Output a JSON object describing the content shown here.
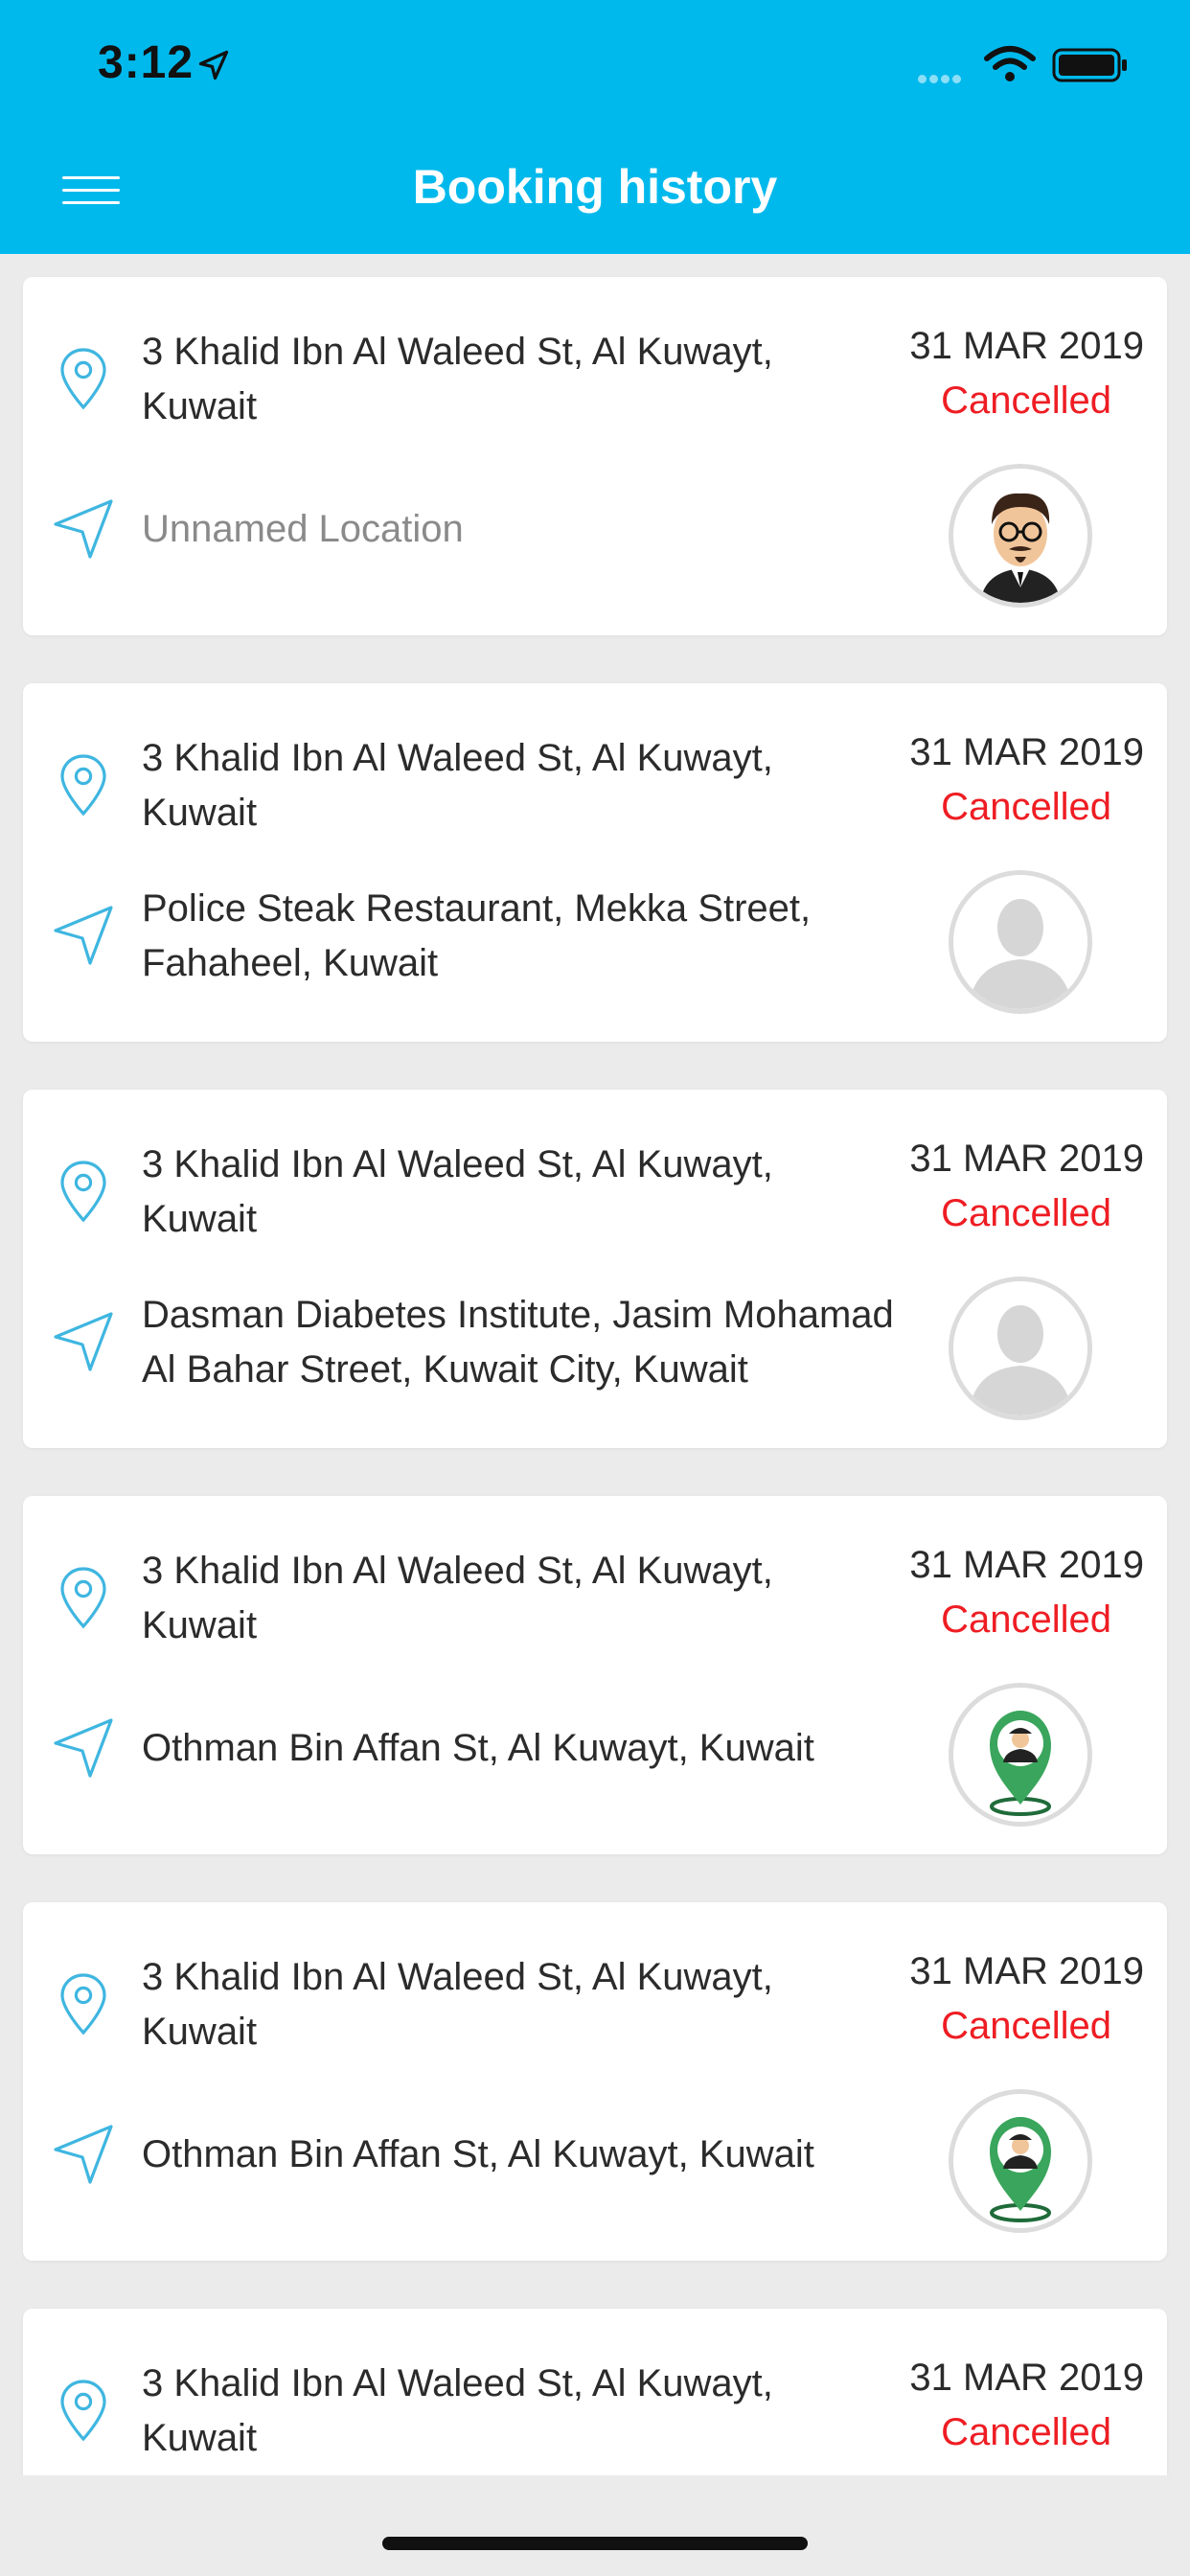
{
  "status_bar": {
    "time": "3:12"
  },
  "header": {
    "title": "Booking history"
  },
  "bookings": [
    {
      "pickup": "3 Khalid Ibn Al Waleed St, Al Kuwayt, Kuwait",
      "dropoff": "Unnamed Location",
      "date": "31 MAR 2019",
      "status": "Cancelled",
      "avatar": "photo-avatar"
    },
    {
      "pickup": "3 Khalid Ibn Al Waleed St, Al Kuwayt, Kuwait",
      "dropoff": "Police Steak Restaurant, Mekka Street, Fahaheel, Kuwait",
      "date": "31 MAR 2019",
      "status": "Cancelled",
      "avatar": "placeholder-avatar"
    },
    {
      "pickup": "3 Khalid Ibn Al Waleed St, Al Kuwayt, Kuwait",
      "dropoff": "Dasman Diabetes Institute, Jasim Mohamad Al Bahar Street, Kuwait City, Kuwait",
      "date": "31 MAR 2019",
      "status": "Cancelled",
      "avatar": "placeholder-avatar"
    },
    {
      "pickup": "3 Khalid Ibn Al Waleed St, Al Kuwayt, Kuwait",
      "dropoff": "Othman Bin Affan St, Al Kuwayt, Kuwait",
      "date": "31 MAR 2019",
      "status": "Cancelled",
      "avatar": "driver-pin-avatar"
    },
    {
      "pickup": "3 Khalid Ibn Al Waleed St, Al Kuwayt, Kuwait",
      "dropoff": "Othman Bin Affan St, Al Kuwayt, Kuwait",
      "date": "31 MAR 2019",
      "status": "Cancelled",
      "avatar": "driver-pin-avatar"
    },
    {
      "pickup": "3 Khalid Ibn Al Waleed St, Al Kuwayt, Kuwait",
      "dropoff": "",
      "date": "31 MAR 2019",
      "status": "Cancelled",
      "avatar": ""
    }
  ],
  "colors": {
    "header": "#00b9ec",
    "accent_icon": "#3fb6e0",
    "cancelled": "#ee1d23",
    "driver_pin": "#3aa55c"
  }
}
